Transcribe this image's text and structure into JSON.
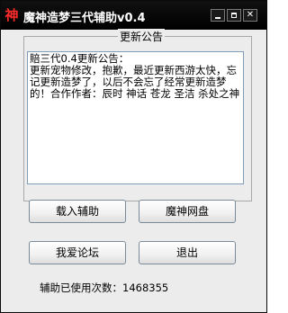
{
  "window": {
    "icon_text": "神",
    "title": "魔神造梦三代辅助v0.4"
  },
  "notice": {
    "group_label": "更新公告",
    "text": "賠三代0.4更新公告：\n更新宠物修改，抱歉，最近更新西游太快，忘记更新造梦了，以后不会忘了经常更新造梦的！合作作者：辰时 神话 苍龙 圣洁 杀处之神"
  },
  "buttons": {
    "load": "载入辅助",
    "disk": "魔神网盘",
    "forum": "我爱论坛",
    "exit": "退出"
  },
  "status": {
    "usage": "辅助已使用次数：1468355"
  }
}
